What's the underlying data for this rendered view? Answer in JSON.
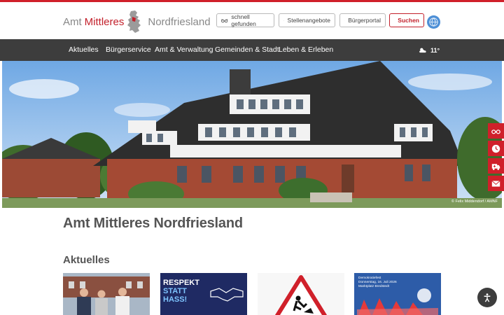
{
  "logo": {
    "part1": "Amt",
    "part2": "Mittleres",
    "part3": "Nordfriesland"
  },
  "header_buttons": [
    {
      "label": "schnell gefunden",
      "icon": "glasses-icon"
    },
    {
      "label": "Stellenangebote",
      "icon": "handshake-icon"
    },
    {
      "label": "Bürgerportal",
      "icon": "user-icon"
    },
    {
      "label": "Suchen",
      "icon": "search-icon"
    }
  ],
  "nav": {
    "items": [
      "Aktuelles",
      "Bürgerservice",
      "Amt & Verwaltung",
      "Gemeinden & Stadt",
      "Leben & Erleben"
    ],
    "weather": {
      "temp": "11°",
      "icon": "cloudy-icon"
    }
  },
  "hero": {
    "credit": "© Felix Middendorf / AMNF"
  },
  "page_title": "Amt Mittleres Nordfriesland",
  "news": {
    "title": "Aktuelles",
    "cards": [
      {
        "type": "photo-people"
      },
      {
        "type": "respekt",
        "line1": "RESPEKT",
        "line2": "STATT",
        "line3": "HASS!"
      },
      {
        "type": "construction-sign"
      },
      {
        "type": "festival",
        "text1": "Demokratiefest",
        "text2": "Donnerstag, 16. Juli 2026",
        "text3": "Marktplatz Bredstedt"
      }
    ]
  },
  "side_tools": [
    "glasses-icon",
    "clock-icon",
    "ambulance-icon",
    "mail-icon"
  ],
  "colors": {
    "accent": "#d0202a",
    "nav": "#3d3d3d",
    "brand_red": "#c3202b"
  }
}
